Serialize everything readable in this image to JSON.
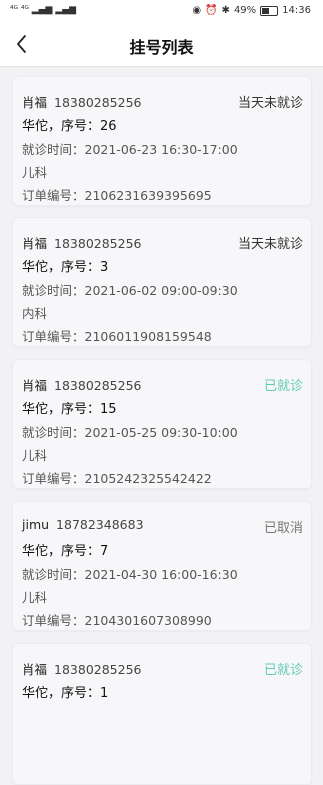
{
  "statusbar": {
    "left_icons": "⁴ᴳ ⁴ᴳ ▂▄▆ ▂▄▆",
    "eye": "◉",
    "alarm": "⏰",
    "bluetooth": "✱",
    "battery": "49%",
    "battery_level": 0.49,
    "time": "14:36"
  },
  "navbar": {
    "title": "挂号列表",
    "back_icon": "chevron-left-icon"
  },
  "orders": [
    {
      "name": "肖福",
      "phone": "18380285256",
      "status": "当天未就诊",
      "status_kind": "pending",
      "doctor": "华佗，序号：26",
      "time": "就诊时间：2021-06-23 16:30-17:00",
      "dept": "儿科",
      "order_no": "订单编号：2106231639395695"
    },
    {
      "name": "肖福",
      "phone": "18380285256",
      "status": "当天未就诊",
      "status_kind": "pending",
      "doctor": "华佗，序号：3",
      "time": "就诊时间：2021-06-02 09:00-09:30",
      "dept": "内科",
      "order_no": "订单编号：2106011908159548"
    },
    {
      "name": "肖福",
      "phone": "18380285256",
      "status": "已就诊",
      "status_kind": "done",
      "doctor": "华佗，序号：15",
      "time": "就诊时间：2021-05-25 09:30-10:00",
      "dept": "儿科",
      "order_no": "订单编号：2105242325542422"
    },
    {
      "name": "jimu",
      "phone": "18782348683",
      "status": "已取消",
      "status_kind": "cancel",
      "doctor": "华佗，序号：7",
      "time": "就诊时间：2021-04-30 16:00-16:30",
      "dept": "儿科",
      "order_no": "订单编号：2104301607308990"
    },
    {
      "name": "肖福",
      "phone": "18380285256",
      "status": "已就诊",
      "status_kind": "done",
      "doctor": "华佗，序号：1",
      "time": "",
      "dept": "",
      "order_no": ""
    }
  ],
  "colors": {
    "done": "#5ecbb2",
    "pending": "#333333",
    "cancel": "#777777"
  }
}
